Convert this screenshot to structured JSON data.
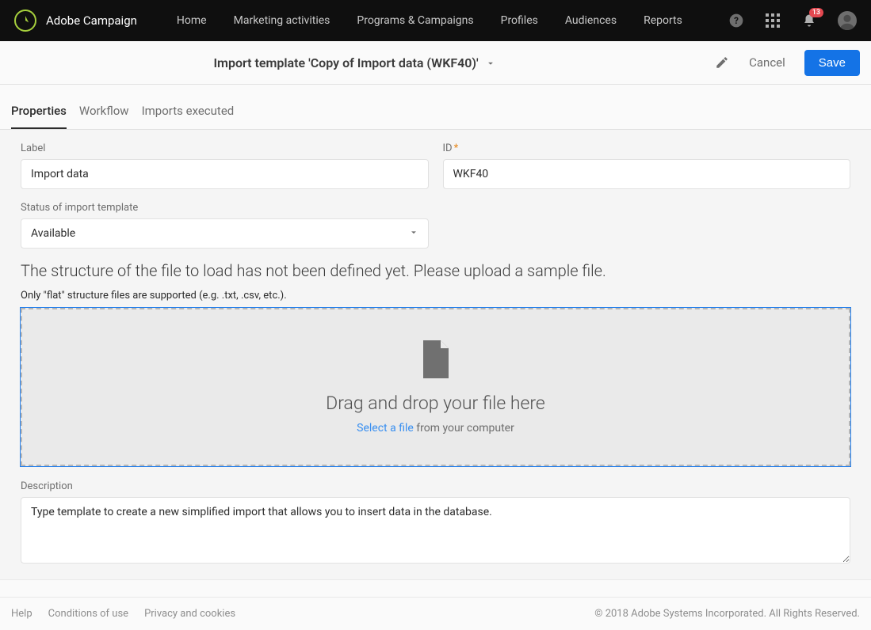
{
  "header": {
    "brand": "Adobe Campaign",
    "nav": [
      {
        "label": "Home"
      },
      {
        "label": "Marketing activities"
      },
      {
        "label": "Programs & Campaigns"
      },
      {
        "label": "Profiles"
      },
      {
        "label": "Audiences"
      },
      {
        "label": "Reports"
      }
    ],
    "notification_count": "13"
  },
  "subheader": {
    "title": "Import template 'Copy of Import data (WKF40)'",
    "cancel": "Cancel",
    "save": "Save"
  },
  "tabs": [
    {
      "label": "Properties",
      "active": true
    },
    {
      "label": "Workflow",
      "active": false
    },
    {
      "label": "Imports executed",
      "active": false
    }
  ],
  "form": {
    "label_field": {
      "label": "Label",
      "value": "Import data"
    },
    "id_field": {
      "label": "ID",
      "value": "WKF40",
      "required": true
    },
    "status_field": {
      "label": "Status of import template",
      "value": "Available"
    },
    "helper_large": "The structure of the file to load has not been defined yet. Please upload a sample file.",
    "helper_small": "Only \"flat\" structure files are supported (e.g. .txt, .csv, etc.).",
    "dropzone": {
      "title": "Drag and drop your file here",
      "link": "Select a file",
      "suffix": " from your computer"
    },
    "description_field": {
      "label": "Description",
      "value": "Type template to create a new simplified import that allows you to insert data in the database."
    }
  },
  "footer": {
    "links": [
      "Help",
      "Conditions of use",
      "Privacy and cookies"
    ],
    "copyright": "© 2018 Adobe Systems Incorporated. All Rights Reserved."
  }
}
